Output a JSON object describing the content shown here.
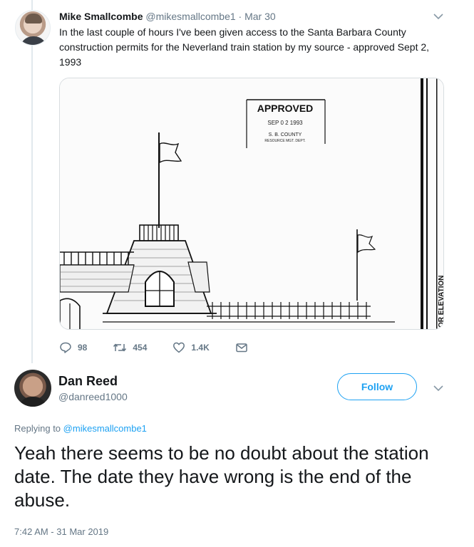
{
  "original_tweet": {
    "author_name": "Mike Smallcombe",
    "handle": "@mikesmallcombe1",
    "separator": "·",
    "date": "Mar 30",
    "text": "In the last couple of hours I've been given access to the Santa Barbara County construction permits for the Neverland train station by my source - approved Sept 2, 1993",
    "image": {
      "stamp_title": "APPROVED",
      "stamp_date": "SEP 0 2 1993",
      "stamp_line1": "S. B. COUNTY",
      "stamp_line2": "RESOURCE MGT. DEPT.",
      "side_label": "OR ELEVATION"
    },
    "actions": {
      "replies": "98",
      "retweets": "454",
      "likes": "1.4K"
    },
    "icons": {
      "caret": "chevron-down-icon",
      "reply": "reply-icon",
      "retweet": "retweet-icon",
      "like": "heart-icon",
      "dm": "envelope-icon"
    }
  },
  "reply_tweet": {
    "author_name": "Dan Reed",
    "handle": "@danreed1000",
    "follow_label": "Follow",
    "replying_prefix": "Replying to",
    "replying_handle": "@mikesmallcombe1",
    "text": "Yeah there seems to be no doubt about the station date. The date they have wrong is the end of the abuse.",
    "timestamp": "7:42 AM - 31 Mar 2019"
  },
  "colors": {
    "accent": "#1da1f2",
    "secondary_text": "#657786",
    "primary_text": "#14171a",
    "thread_line": "#e1e8ed"
  }
}
